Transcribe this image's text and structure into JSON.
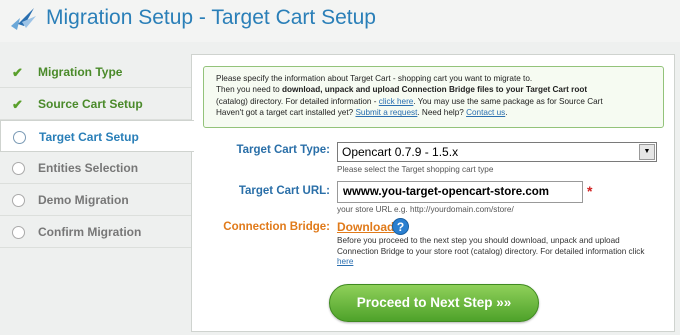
{
  "header": {
    "title": "Migration Setup - Target Cart Setup",
    "logo_icon": "bird-logo-icon"
  },
  "sidebar": {
    "steps": [
      {
        "label": "Migration Type",
        "status": "done"
      },
      {
        "label": "Source Cart Setup",
        "status": "done"
      },
      {
        "label": "Target Cart Setup",
        "status": "active"
      },
      {
        "label": "Entities Selection",
        "status": "todo"
      },
      {
        "label": "Demo Migration",
        "status": "todo"
      },
      {
        "label": "Confirm Migration",
        "status": "todo"
      }
    ]
  },
  "info": {
    "line1": "Please specify the information about Target Cart - shopping cart you want to migrate to.",
    "line2_pre": "Then you need to ",
    "line2_bold": "download, unpack and upload Connection Bridge files to your Target Cart root",
    "line3_pre": "(catalog) directory. For detailed information - ",
    "line3_link": "click here",
    "line3_post": ". You may use the same package as for Source Cart",
    "line4_pre": "Haven't got a target cart installed yet? ",
    "line4_link1": "Submit a request",
    "line4_mid": ". Need help? ",
    "line4_link2": "Contact us",
    "line4_post": "."
  },
  "form": {
    "cart_type_label": "Target Cart Type:",
    "cart_type_value": "Opencart 0.7.9 - 1.5.x",
    "cart_type_hint": "Please select the Target shopping cart type",
    "cart_url_label": "Target Cart URL:",
    "cart_url_value": "wwww.you-target-opencart-store.com",
    "cart_url_hint": "your store URL e.g. http://yourdomain.com/store/",
    "required_mark": "*",
    "bridge_label": "Connection Bridge:",
    "bridge_link": "Download",
    "help_glyph": "?",
    "bridge_desc": "Before you proceed to the next step you should download, unpack and upload Connection Bridge to your store root (catalog) directory. For detailed information click",
    "bridge_desc_link": "here"
  },
  "actions": {
    "next_label": "Proceed to Next Step »»"
  },
  "colors": {
    "title_blue": "#2a7fb8",
    "done_green": "#4a8a2a",
    "accent_orange": "#e07a1a",
    "button_green": "#4ea22a"
  }
}
